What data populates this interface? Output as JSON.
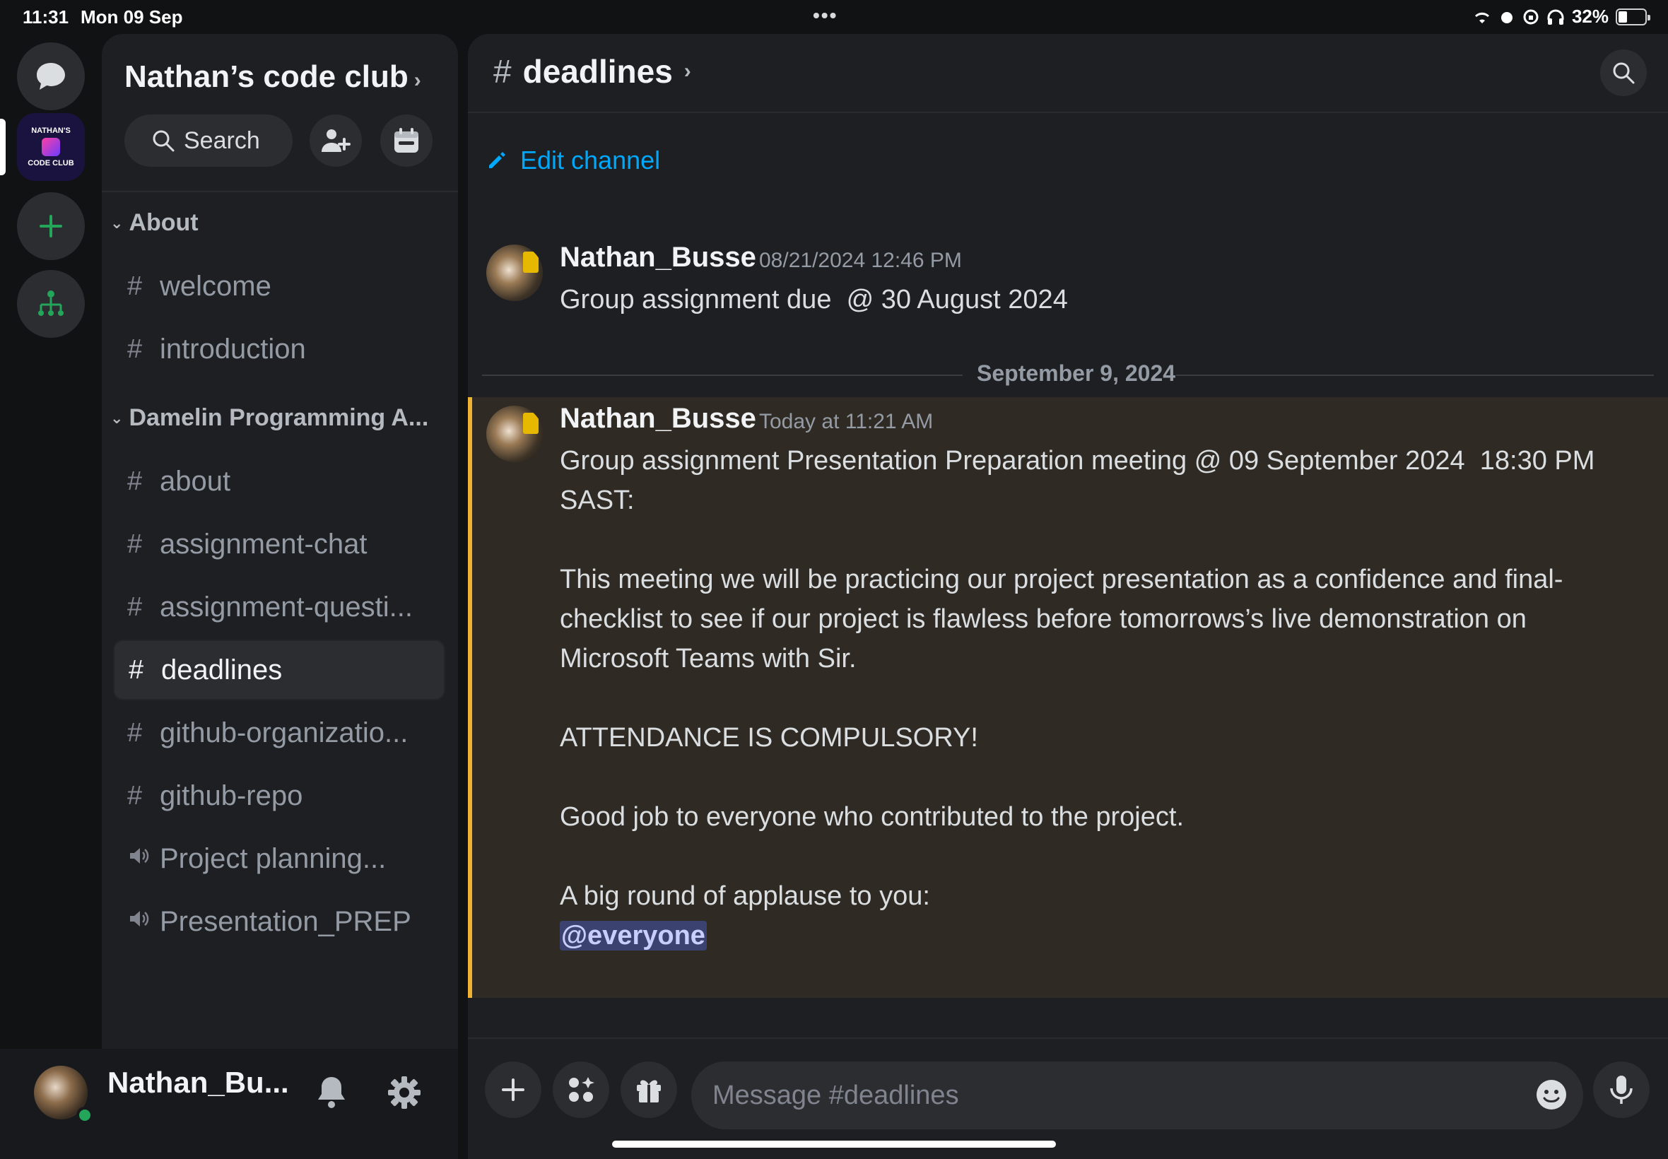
{
  "status_bar": {
    "time": "11:31",
    "date": "Mon 09 Sep",
    "battery": "32%"
  },
  "server_rail": {
    "server_logo_line1": "NATHAN'S",
    "server_logo_line2": "CODE CLUB"
  },
  "sidebar": {
    "server_name": "Nathan’s code club",
    "search_label": "Search",
    "categories": [
      {
        "label": "About"
      },
      {
        "label": "Damelin Programming A..."
      }
    ],
    "channels": [
      {
        "label": "welcome",
        "kind": "text"
      },
      {
        "label": "introduction",
        "kind": "text"
      },
      {
        "label": "about",
        "kind": "text"
      },
      {
        "label": "assignment-chat",
        "kind": "text"
      },
      {
        "label": "assignment-questi...",
        "kind": "text"
      },
      {
        "label": "deadlines",
        "kind": "text",
        "active": true
      },
      {
        "label": "github-organizatio...",
        "kind": "text"
      },
      {
        "label": "github-repo",
        "kind": "text"
      },
      {
        "label": "Project planning...",
        "kind": "voice"
      },
      {
        "label": "Presentation_PREP",
        "kind": "voice"
      }
    ]
  },
  "user_panel": {
    "username": "Nathan_Bu...",
    "status": "online"
  },
  "main": {
    "channel_name": "deadlines",
    "edit_channel_label": "Edit channel",
    "messages": [
      {
        "author": "Nathan_Busse",
        "timestamp": "08/21/2024 12:46 PM",
        "text": "Group assignment due  @ 30 August 2024"
      },
      {
        "author": "Nathan_Busse",
        "timestamp": "Today at 11:21 AM",
        "text": "Group assignment Presentation Preparation meeting @ 09 September 2024  18:30 PM\nSAST:\n\nThis meeting we will be practicing our project presentation as a confidence and final-\nchecklist to see if our project is flawless before tomorrows’s live demonstration on\nMicrosoft Teams with Sir.\n\nATTENDANCE IS COMPULSORY!\n\nGood job to everyone who contributed to the project.\n\nA big round of applause to you:\n",
        "mention": "@everyone"
      }
    ],
    "date_divider": "September 9, 2024",
    "composer_placeholder": "Message #deadlines"
  },
  "colors": {
    "accent_link": "#00a8fc",
    "highlight_bar": "#f0b232",
    "online": "#23a55a",
    "add_server": "#23a55a"
  },
  "icons": [
    "chat-bubble-icon",
    "plus-icon",
    "hub-icon",
    "search-icon",
    "add-member-icon",
    "calendar-icon",
    "bell-icon",
    "gear-icon",
    "pencil-icon",
    "gift-icon",
    "apps-icon",
    "emoji-icon",
    "microphone-icon",
    "speaker-icon"
  ]
}
